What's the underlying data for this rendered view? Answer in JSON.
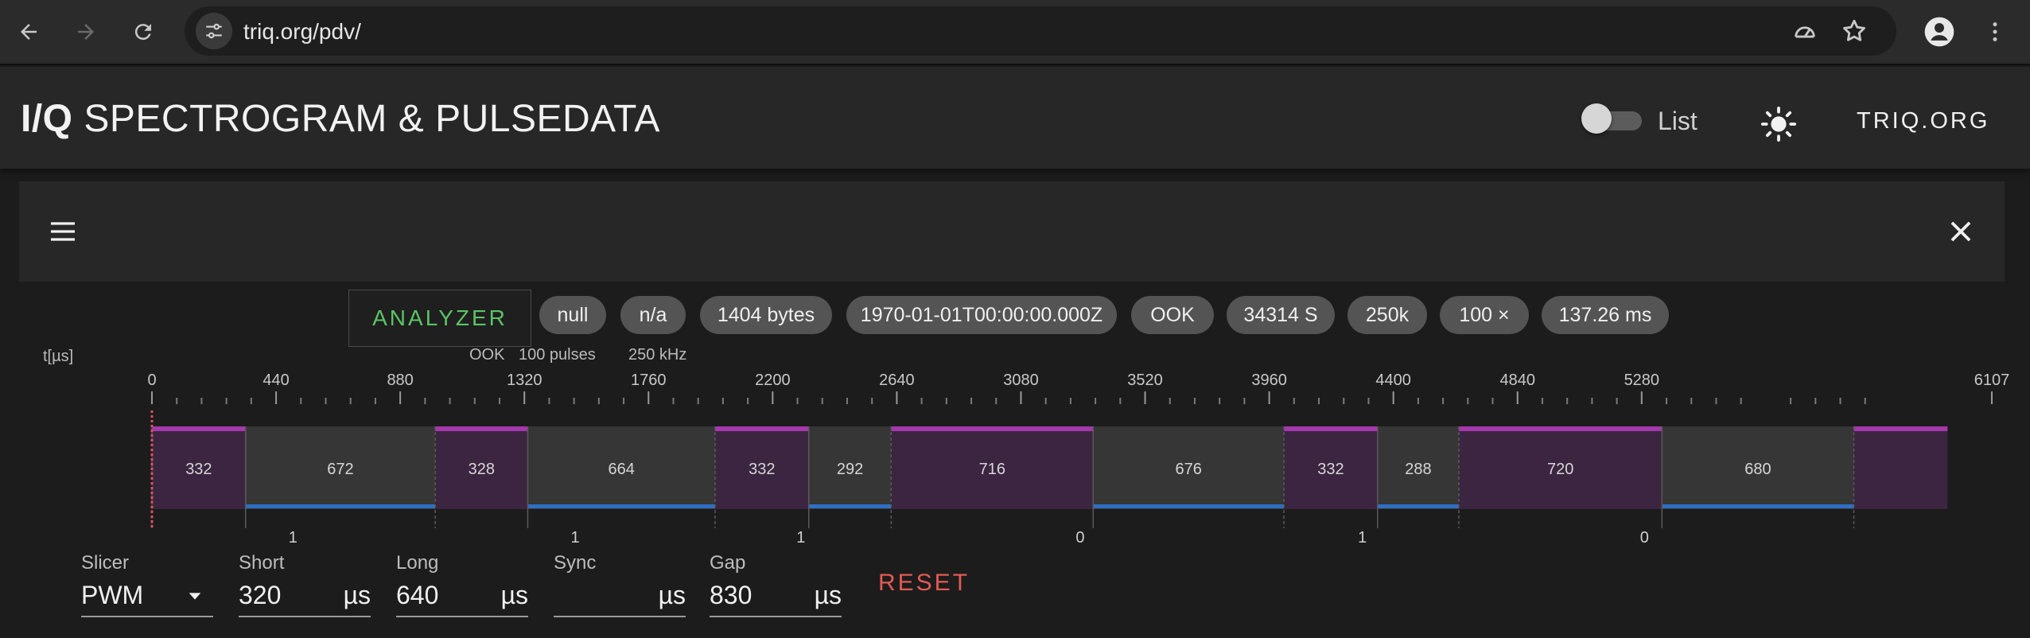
{
  "browser": {
    "url": "triq.org/pdv/"
  },
  "header": {
    "title_bold": "I/Q",
    "title_rest": " SPECTROGRAM & PULSEDATA",
    "list_label": "List",
    "site_link": "TRIQ.ORG"
  },
  "chips": {
    "analyzer": "ANALYZER",
    "items": [
      "null",
      "n/a",
      "1404 bytes",
      "1970-01-01T00:00:00.000Z",
      "OOK",
      "34314 S",
      "250k",
      "100 ×",
      "137.26 ms"
    ]
  },
  "pulse": {
    "axis_unit": "t[µs]",
    "info_modulation": "OOK",
    "info_pulses": "100 pulses",
    "info_rate": "250 kHz",
    "axis_ticks": [
      "0",
      "440",
      "880",
      "1320",
      "1760",
      "2200",
      "2640",
      "3080",
      "3520",
      "3960",
      "4400",
      "4840",
      "5280",
      "6107"
    ],
    "axis_tick_values": [
      0,
      440,
      880,
      1320,
      1760,
      2200,
      2640,
      3080,
      3520,
      3960,
      4400,
      4840,
      5280,
      6107
    ],
    "segments": [
      {
        "type": "pulse",
        "width_us": 332,
        "label": "332"
      },
      {
        "type": "gap",
        "width_us": 672,
        "label": "672"
      },
      {
        "type": "pulse",
        "width_us": 328,
        "label": "328"
      },
      {
        "type": "gap",
        "width_us": 664,
        "label": "664"
      },
      {
        "type": "pulse",
        "width_us": 332,
        "label": "332"
      },
      {
        "type": "gap",
        "width_us": 292,
        "label": "292"
      },
      {
        "type": "pulse",
        "width_us": 716,
        "label": "716"
      },
      {
        "type": "gap",
        "width_us": 676,
        "label": "676"
      },
      {
        "type": "pulse",
        "width_us": 332,
        "label": "332"
      },
      {
        "type": "gap",
        "width_us": 288,
        "label": "288"
      },
      {
        "type": "pulse",
        "width_us": 720,
        "label": "720"
      },
      {
        "type": "gap",
        "width_us": 680,
        "label": "680"
      },
      {
        "type": "pulse",
        "width_us": 332,
        "label": ""
      }
    ],
    "bits": [
      {
        "at_us": 500,
        "value": "1"
      },
      {
        "at_us": 1500,
        "value": "1"
      },
      {
        "at_us": 2300,
        "value": "1"
      },
      {
        "at_us": 3290,
        "value": "0"
      },
      {
        "at_us": 4290,
        "value": "1"
      },
      {
        "at_us": 5290,
        "value": "0"
      }
    ],
    "colors": {
      "pulse_fill": "#3b2540",
      "pulse_top": "#a637ad",
      "gap_fill": "#363636",
      "gap_bottom": "#2e6fc5",
      "label": "#d6d6d6"
    }
  },
  "slicer": {
    "slicer_label": "Slicer",
    "slicer_value": "PWM",
    "short_label": "Short",
    "short_value": "320",
    "long_label": "Long",
    "long_value": "640",
    "sync_label": "Sync",
    "sync_value": "",
    "gap_label": "Gap",
    "gap_value": "830",
    "unit": "µs",
    "reset_label": "RESET"
  }
}
